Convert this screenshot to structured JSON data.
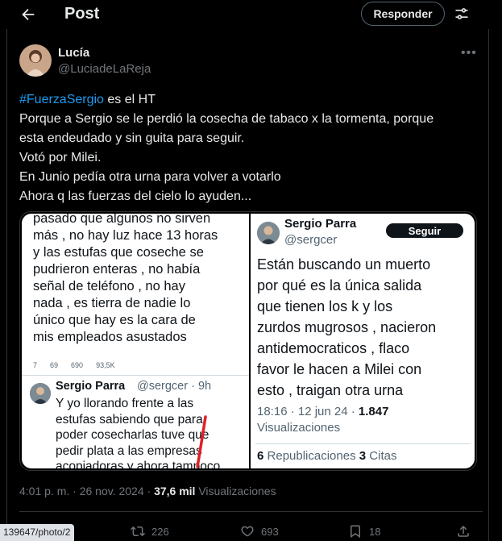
{
  "header": {
    "title": "Post",
    "reply_button": "Responder"
  },
  "author": {
    "name": "Lucía",
    "handle": "@LuciadeLaReja"
  },
  "tweet": {
    "hashtag": "#FuerzaSergio",
    "line1_rest": " es el HT",
    "line2": "Porque a Sergio se le perdió la cosecha de tabaco x la tormenta,  porque",
    "line3": "esta endeudado y sin guita para seguir.",
    "line4": "Votó por Milei.",
    "line5": "En Junio pedía otra urna para volver a votarlo",
    "line6": "Ahora q las fuerzas del cielo lo ayuden..."
  },
  "media_left": {
    "lines": [
      "pasado que algunos no sirven",
      "más , no hay luz hace 13 horas",
      "y las estufas que coseche se",
      "pudrieron enteras , no había",
      "señal de teléfono , no hay",
      "nada , es tierra de nadie lo",
      "único que hay es la cara de",
      "mis empleados asustados"
    ],
    "stats": [
      "7",
      "69",
      "690",
      "93,5K"
    ],
    "reply_name": "Sergio Parra",
    "reply_handle": "@sergcer · 9h",
    "reply_lines": [
      "Y yo llorando frente a las",
      "estufas sabiendo que para",
      "poder cosecharlas tuve que",
      "pedir plata a las empresas",
      "acopiadoras y ahora tampoco"
    ]
  },
  "media_right": {
    "name": "Sergio Parra",
    "handle": "@sergcer",
    "follow": "Seguir",
    "body_lines": [
      "Están buscando un muerto",
      "por qué es la única salida",
      "que tienen los k y los",
      "zurdos mugrosos , nacieron",
      "antidemocraticos , flaco",
      "favor le hacen a Milei con",
      "esto , traigan otra urna"
    ],
    "meta_time": "18:16 · 12 jun 24 · ",
    "meta_views_count": "1.847",
    "meta_views_label": "Visualizaciones",
    "reposts_count": "6",
    "reposts_label": "Republicaciones",
    "quotes_count": "3",
    "quotes_label": "Citas"
  },
  "footer": {
    "time": "4:01 p. m. · 26 nov. 2024 · ",
    "views_count": "37,6 mil",
    "views_label": " Visualizaciones"
  },
  "actions": {
    "reposts": "226",
    "likes": "693",
    "bookmarks": "18"
  },
  "status_url": "139647/photo/2",
  "icons": {
    "back": "arrow-left-icon",
    "adjust": "sliders-icon",
    "more": "more-horizontal-icon",
    "repost": "repost-icon",
    "like": "heart-icon",
    "bookmark": "bookmark-icon",
    "share": "share-icon"
  },
  "colors": {
    "background": "#000000",
    "text": "#e7e9ea",
    "muted": "#71767b",
    "link": "#1d9bf0",
    "border": "#2f3336"
  }
}
